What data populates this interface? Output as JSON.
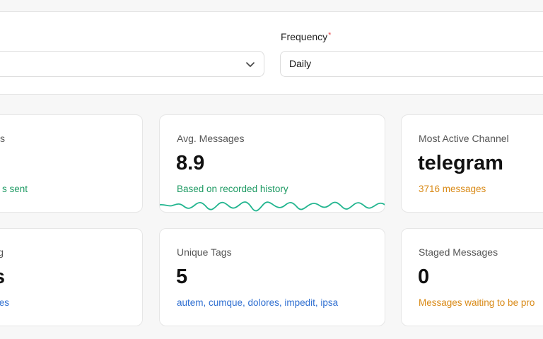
{
  "filters": {
    "frequency_label": "Frequency",
    "required_mark": "*",
    "frequency_value": "Daily"
  },
  "cards": {
    "messages": {
      "title": "es",
      "value": "",
      "subtitle": "s sent"
    },
    "avg_messages": {
      "title": "Avg. Messages",
      "value": "8.9",
      "subtitle": "Based on recorded history"
    },
    "most_active_channel": {
      "title": "Most Active Channel",
      "value": "telegram",
      "subtitle": "3716 messages"
    },
    "left_bottom": {
      "title": "g",
      "value": "s",
      "subtitle": "es"
    },
    "unique_tags": {
      "title": "Unique Tags",
      "value": "5",
      "subtitle": "autem, cumque, dolores, impedit, ipsa"
    },
    "staged_messages": {
      "title": "Staged Messages",
      "value": "0",
      "subtitle": "Messages waiting to be pro"
    }
  },
  "colors": {
    "positive": "#1e9a63",
    "warning": "#d98a17",
    "link": "#2f6fd1",
    "sparkline": "#22b58f"
  }
}
